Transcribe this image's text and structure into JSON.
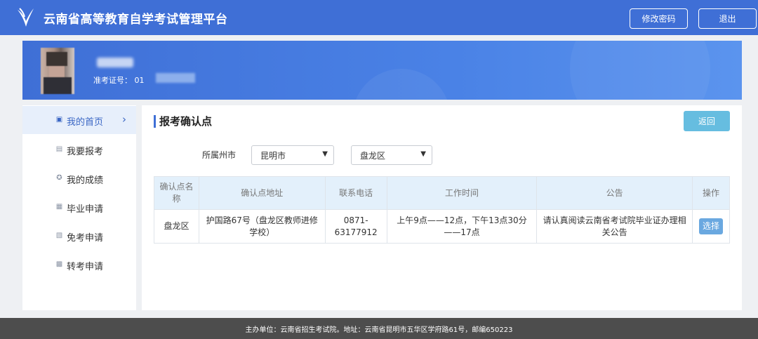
{
  "header": {
    "title": "云南省高等教育自学考试管理平台",
    "change_password": "修改密码",
    "logout": "退出",
    "logo_icon": "swoosh-logo-icon"
  },
  "profile": {
    "ticket_label": "准考证号：",
    "ticket_prefix": "01"
  },
  "sidebar": {
    "items": [
      {
        "label": "我的首页",
        "icon": "user-card-icon",
        "active": true
      },
      {
        "label": "我要报考",
        "icon": "document-icon",
        "active": false
      },
      {
        "label": "我的成绩",
        "icon": "medal-icon",
        "active": false
      },
      {
        "label": "毕业申请",
        "icon": "graduate-icon",
        "active": false
      },
      {
        "label": "免考申请",
        "icon": "exempt-icon",
        "active": false
      },
      {
        "label": "转考申请",
        "icon": "transfer-icon",
        "active": false
      }
    ]
  },
  "main": {
    "section_title": "报考确认点",
    "back_button": "返回",
    "filter_label": "所属州市",
    "city_value": "昆明市",
    "district_value": "盘龙区",
    "table": {
      "headers": [
        "确认点名称",
        "确认点地址",
        "联系电话",
        "工作时间",
        "公告",
        "操作"
      ],
      "rows": [
        {
          "name": "盘龙区",
          "address": "护国路67号（盘龙区教师进修学校）",
          "phone": "0871-63177912",
          "hours": "上午9点——12点，下午13点30分——17点",
          "notice": "请认真阅读云南省考试院毕业证办理相关公告",
          "action": "选择"
        }
      ]
    }
  },
  "footer": {
    "text": "主办单位：云南省招生考试院。地址：云南省昆明市五华区学府路61号，邮编650223"
  },
  "colors": {
    "header_bg": "#3f6fd6",
    "accent": "#3a66c4",
    "back_button": "#66bde0",
    "footer_bg": "#4d4d4d"
  }
}
